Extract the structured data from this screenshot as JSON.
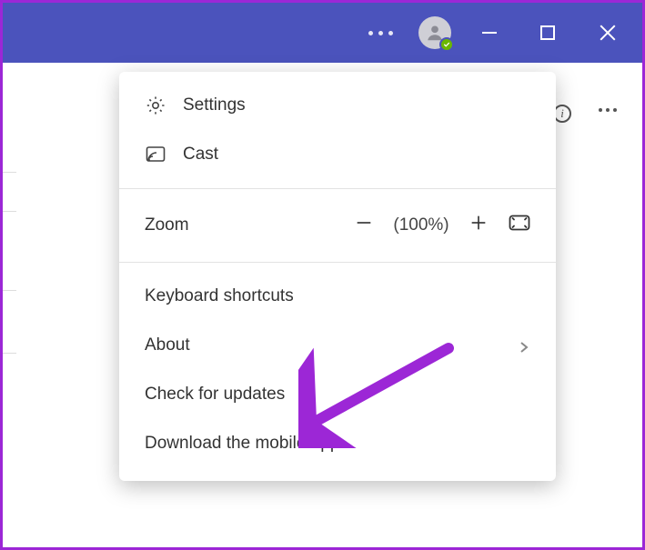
{
  "titlebar": {
    "avatar_presence": "available"
  },
  "background": {
    "info_glyph": "i"
  },
  "menu": {
    "settings_label": "Settings",
    "cast_label": "Cast",
    "zoom_label": "Zoom",
    "zoom_value": "(100%)",
    "keyboard_shortcuts_label": "Keyboard shortcuts",
    "about_label": "About",
    "check_updates_label": "Check for updates",
    "download_mobile_label": "Download the mobile app"
  },
  "annotation": {
    "arrow_color": "#9c27d6",
    "points_to": "check-for-updates"
  }
}
